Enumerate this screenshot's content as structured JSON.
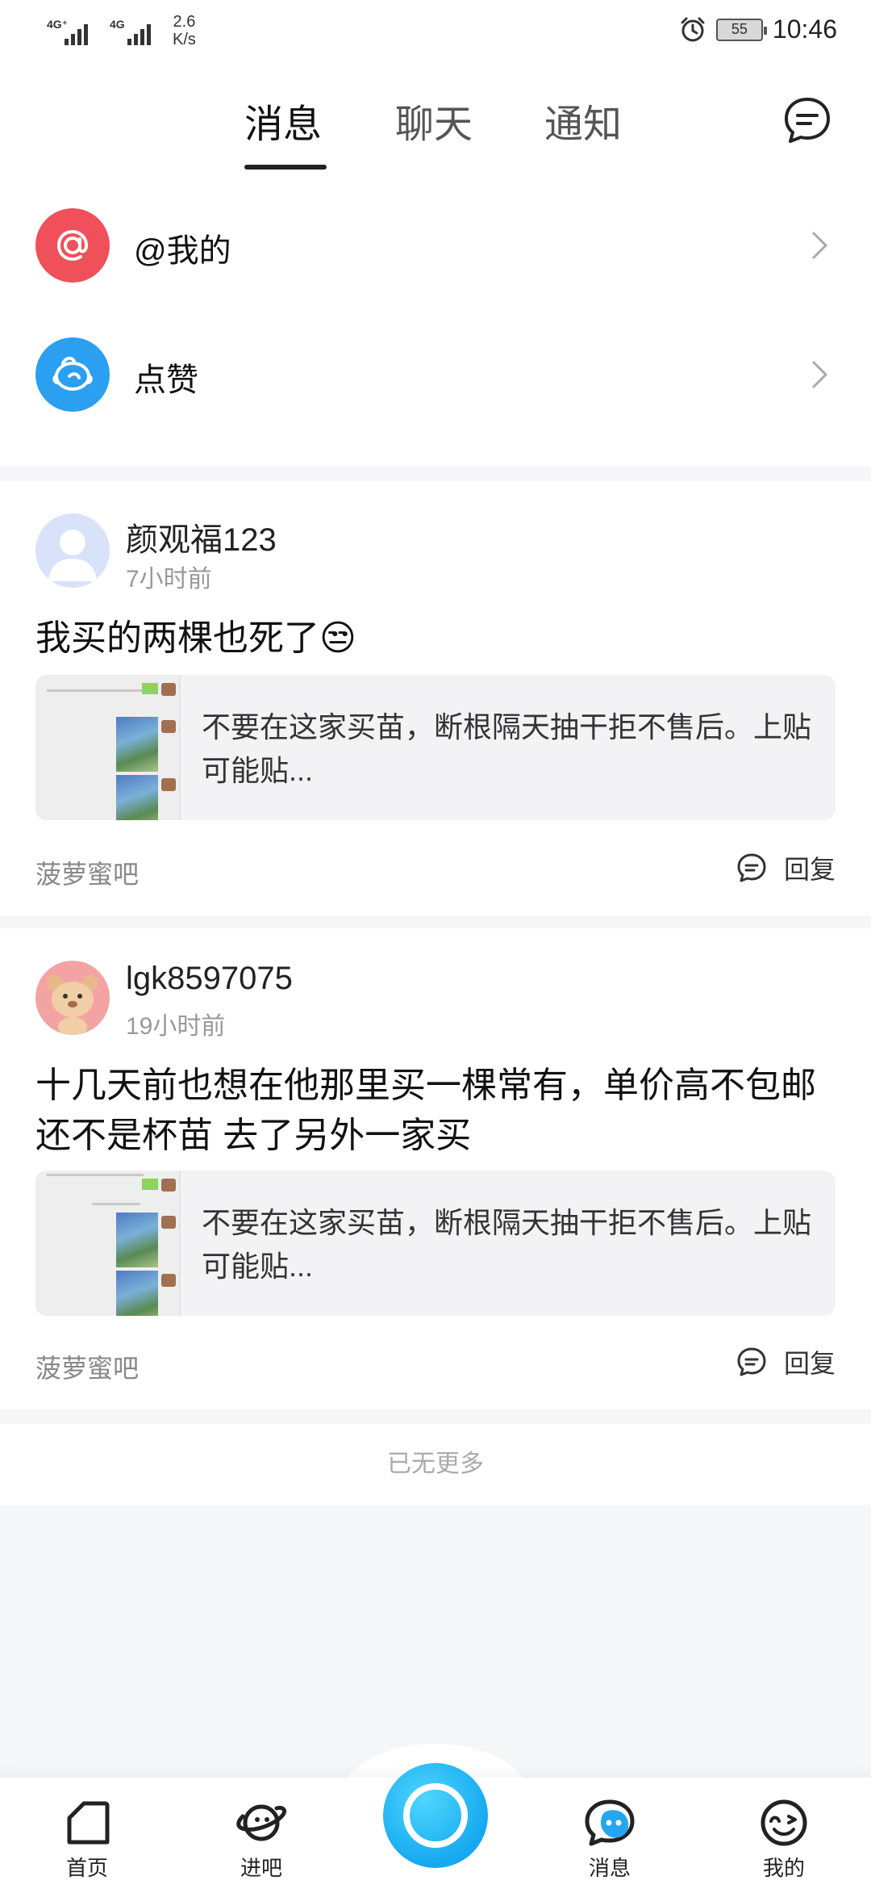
{
  "status_bar": {
    "net1": "4G⁺",
    "net2": "4G",
    "speed_value": "2.6",
    "speed_unit": "K/s",
    "battery": "55",
    "time": "10:46",
    "icons": [
      "signal-icon",
      "alarm-icon",
      "battery-icon"
    ]
  },
  "tabs": [
    {
      "label": "消息",
      "active": true
    },
    {
      "label": "聊天",
      "active": false
    },
    {
      "label": "通知",
      "active": false
    }
  ],
  "notify_rows": [
    {
      "label": "@我的",
      "icon": "at-icon",
      "color": "#f0505a"
    },
    {
      "label": "点赞",
      "icon": "thumbs-up-icon",
      "color": "#2b9ff0"
    }
  ],
  "posts": [
    {
      "username": "颜观福123",
      "time": "7小时前",
      "content": "我买的两棵也死了😒",
      "quote": "不要在这家买苗，断根隔天抽干拒不售后。上贴可能贴...",
      "forum": "菠萝蜜吧",
      "reply": "回复"
    },
    {
      "username": "lgk8597075",
      "time": "19小时前",
      "content": "十几天前也想在他那里买一棵常有，单价高不包邮还不是杯苗 去了另外一家买",
      "quote": "不要在这家买苗，断根隔天抽干拒不售后。上贴可能贴...",
      "forum": "菠萝蜜吧",
      "reply": "回复"
    }
  ],
  "no_more": "已无更多",
  "bottom_nav": [
    {
      "label": "首页",
      "icon": "home-icon"
    },
    {
      "label": "进吧",
      "icon": "planet-icon"
    },
    {
      "label": "",
      "icon": "camera-icon"
    },
    {
      "label": "消息",
      "icon": "message-icon"
    },
    {
      "label": "我的",
      "icon": "profile-icon"
    }
  ],
  "colors": {
    "accent": "#16a9f0",
    "at_red": "#f0505a",
    "like_blue": "#2b9ff0"
  }
}
